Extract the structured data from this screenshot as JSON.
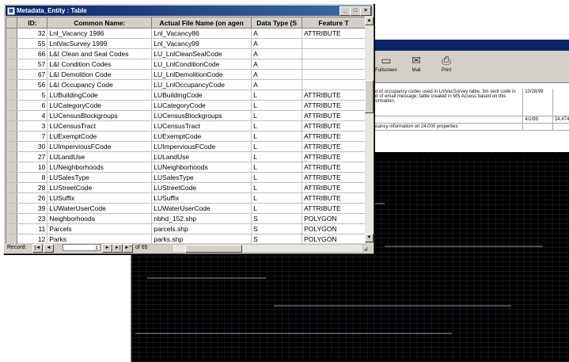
{
  "background_window": {
    "toolbar": [
      {
        "label": "Fullscreen",
        "icon": "fullscreen-icon"
      },
      {
        "label": "Mail",
        "icon": "mail-icon"
      },
      {
        "label": "Print",
        "icon": "print-icon"
      }
    ],
    "sheet_rows": [
      {
        "text": "List of occupancy codes used in LnlVacSurvey table. 3m sent code in text of email message; table created in MS Access based on this information.",
        "date": "10/28/99",
        "count": ""
      },
      {
        "text": "",
        "date": "4/1/99",
        "count": "24,474"
      },
      {
        "text": "Vacancy information on 24,000 properties",
        "date": "",
        "count": ""
      }
    ]
  },
  "window": {
    "title": "Metadata_Entity : Table",
    "minimize": "_",
    "maximize": "□",
    "close": "×"
  },
  "table": {
    "columns": [
      "ID:",
      "Common Name:",
      "Actual File Name (on agen",
      "Data Type (S",
      "Feature T"
    ],
    "rows": [
      {
        "id": "32",
        "name": "Lnl_Vacancy 1986",
        "file": "Lnl_Vacancy86",
        "type": "A",
        "feature": "ATTRIBUTE"
      },
      {
        "id": "55",
        "name": "LnlVacSurvey 1999",
        "file": "Lnl_Vacancy99",
        "type": "A",
        "feature": ""
      },
      {
        "id": "66",
        "name": "L&I Clean and Seal Codes",
        "file": "LU_LnlCleanSealCode",
        "type": "A",
        "feature": ""
      },
      {
        "id": "57",
        "name": "L&I Condition Codes",
        "file": "LU_LnlConditionCode",
        "type": "A",
        "feature": ""
      },
      {
        "id": "67",
        "name": "L&I Demolition Code",
        "file": "LU_LnlDemolitionCode",
        "type": "A",
        "feature": ""
      },
      {
        "id": "56",
        "name": "L&I Occupancy Code",
        "file": "LU_LnlOccupancyCode",
        "type": "A",
        "feature": ""
      },
      {
        "id": "5",
        "name": "LUBuildingCode",
        "file": "LUBuildingCode",
        "type": "L",
        "feature": "ATTRIBUTE"
      },
      {
        "id": "6",
        "name": "LUCategoryCode",
        "file": "LUCategoryCode",
        "type": "L",
        "feature": "ATTRIBUTE"
      },
      {
        "id": "4",
        "name": "LUCensusBlockgroups",
        "file": "LUCensusBlockgroups",
        "type": "L",
        "feature": "ATTRIBUTE"
      },
      {
        "id": "3",
        "name": "LUCensusTract",
        "file": "LUCensusTract",
        "type": "L",
        "feature": "ATTRIBUTE"
      },
      {
        "id": "7",
        "name": "LUExemptCode",
        "file": "LUExemptCode",
        "type": "L",
        "feature": "ATTRIBUTE"
      },
      {
        "id": "30",
        "name": "LUImperviousFCode",
        "file": "LUImperviousFCode",
        "type": "L",
        "feature": "ATTRIBUTE"
      },
      {
        "id": "27",
        "name": "LULandUse",
        "file": "LULandUse",
        "type": "L",
        "feature": "ATTRIBUTE"
      },
      {
        "id": "10",
        "name": "LUNeighborhoods",
        "file": "LUNeighborhoods",
        "type": "L",
        "feature": "ATTRIBUTE"
      },
      {
        "id": "8",
        "name": "LUSalesType",
        "file": "LUSalesType",
        "type": "L",
        "feature": "ATTRIBUTE"
      },
      {
        "id": "28",
        "name": "LUStreetCode",
        "file": "LUStreetCode",
        "type": "L",
        "feature": "ATTRIBUTE"
      },
      {
        "id": "26",
        "name": "LUSuffix",
        "file": "LUSuffix",
        "type": "L",
        "feature": "ATTRIBUTE"
      },
      {
        "id": "39",
        "name": "LUWaterUserCode",
        "file": "LUWaterUserCode",
        "type": "L",
        "feature": "ATTRIBUTE"
      },
      {
        "id": "23",
        "name": "Neighborhoods",
        "file": "nbhd_152.shp",
        "type": "S",
        "feature": "POLYGON"
      },
      {
        "id": "11",
        "name": "Parcels",
        "file": "parcels.shp",
        "type": "S",
        "feature": "POLYGON"
      },
      {
        "id": "12",
        "name": "Parks",
        "file": "parks.shp",
        "type": "S",
        "feature": "POLYGON"
      }
    ]
  },
  "navigator": {
    "label": "Record:",
    "first": "|◄",
    "prev": "◄",
    "current": "1",
    "next": "►",
    "last": "►|",
    "new": "►*",
    "of_text": "of 65"
  }
}
